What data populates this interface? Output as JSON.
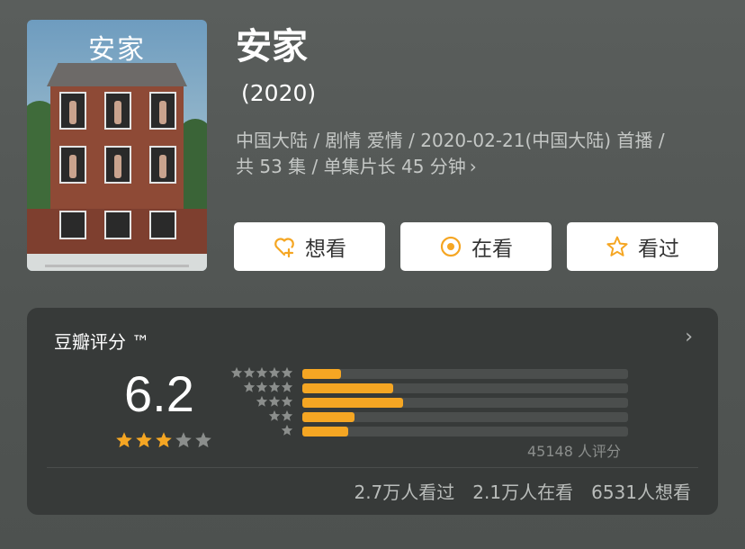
{
  "poster": {
    "title": "安家"
  },
  "title": "安家",
  "year": "(2020)",
  "meta": {
    "line1": "中国大陆 / 剧情 爱情 / 2020-02-21(中国大陆) 首播 /",
    "line2": "共 53 集 / 单集片长 45 分钟"
  },
  "actions": {
    "want": "想看",
    "watching": "在看",
    "watched": "看过"
  },
  "rating": {
    "label": "豆瓣评分 ™",
    "score": "6.2",
    "stars_filled": 3,
    "stars_total": 5,
    "distribution": [
      {
        "stars": 5,
        "fraction": 0.12
      },
      {
        "stars": 4,
        "fraction": 0.28
      },
      {
        "stars": 3,
        "fraction": 0.31
      },
      {
        "stars": 2,
        "fraction": 0.16
      },
      {
        "stars": 1,
        "fraction": 0.14
      }
    ],
    "count": "45148 人评分"
  },
  "stats": {
    "watched": "2.7万人看过",
    "watching": "2.1万人在看",
    "want": "6531人想看"
  },
  "colors": {
    "accent": "#f5a623",
    "card": "#373a39",
    "background": "#545856",
    "empty_star": "#8b8e8c"
  },
  "icons": {
    "want": "heart-plus-icon",
    "watching": "target-icon",
    "watched": "star-outline-icon",
    "more": "chevron-right-icon"
  }
}
